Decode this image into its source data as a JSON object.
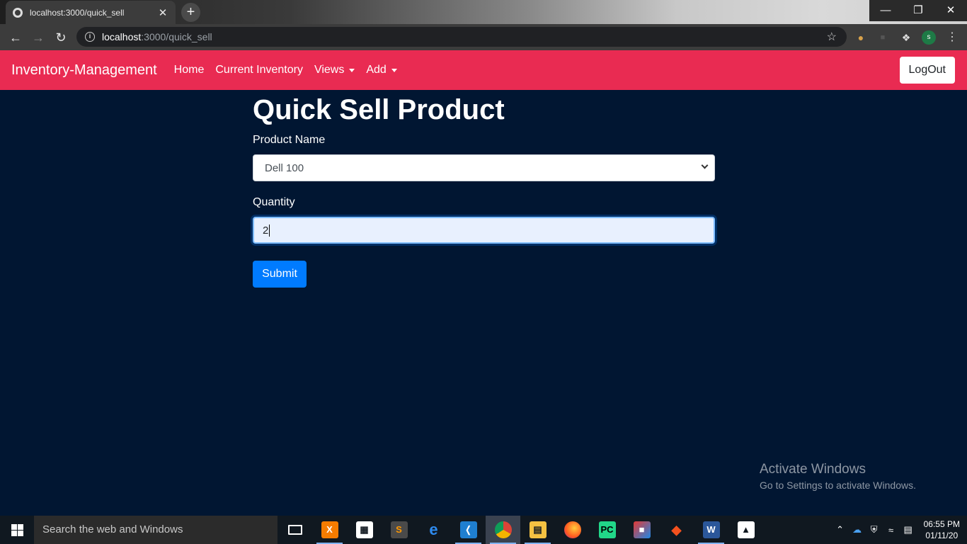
{
  "browser": {
    "tab_title": "localhost:3000/quick_sell",
    "tab_close": "✕",
    "new_tab": "+",
    "url_host": "localhost",
    "url_path": ":3000/quick_sell",
    "window_controls": {
      "minimize": "—",
      "restore": "❐",
      "close": "✕"
    },
    "profile_initial": "s"
  },
  "navbar": {
    "brand": "Inventory-Management",
    "links": [
      {
        "label": "Home"
      },
      {
        "label": "Current Inventory"
      },
      {
        "label": "Views"
      },
      {
        "label": "Add"
      }
    ],
    "logout": "LogOut",
    "accent_color": "#e92b52"
  },
  "form": {
    "title": "Quick Sell Product",
    "product_label": "Product Name",
    "product_selected": "Dell 100",
    "quantity_label": "Quantity",
    "quantity_value": "2",
    "submit_label": "Submit",
    "submit_color": "#007bff"
  },
  "watermark": {
    "line1": "Activate Windows",
    "line2": "Go to Settings to activate Windows."
  },
  "taskbar": {
    "search_placeholder": "Search the web and Windows",
    "apps": [
      {
        "icon": "task-view-icon"
      },
      {
        "icon": "xampp-icon"
      },
      {
        "icon": "store-icon"
      },
      {
        "icon": "sublime-icon"
      },
      {
        "icon": "edge-icon"
      },
      {
        "icon": "vscode-icon"
      },
      {
        "icon": "chrome-icon"
      },
      {
        "icon": "file-explorer-icon"
      },
      {
        "icon": "firefox-icon"
      },
      {
        "icon": "pycharm-icon"
      },
      {
        "icon": "app-icon"
      },
      {
        "icon": "git-icon"
      },
      {
        "icon": "word-icon"
      },
      {
        "icon": "photos-icon"
      }
    ],
    "time": "06:55 PM",
    "date": "01/11/20"
  },
  "colors": {
    "page_background": "#011632",
    "navbar": "#e92b52",
    "primary": "#007bff"
  }
}
